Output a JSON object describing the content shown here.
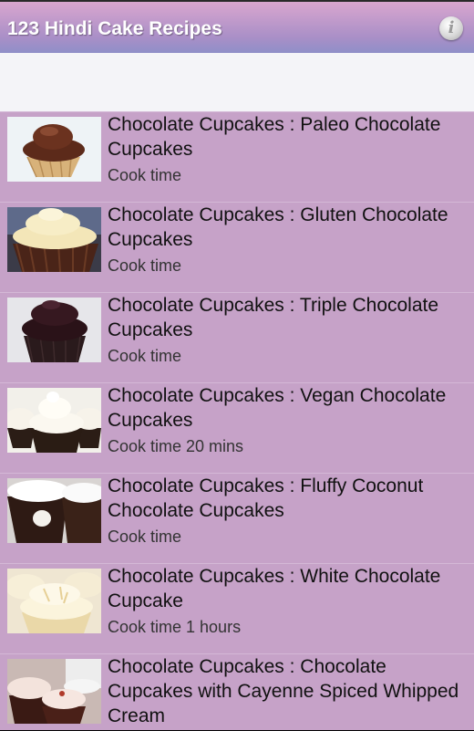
{
  "app": {
    "title": "123 Hindi Cake Recipes",
    "info_icon": "info-icon"
  },
  "colors": {
    "list_background": "#c6a2c8",
    "titlebar_top": "#d9a6cf",
    "titlebar_bottom": "#8f8fc8"
  },
  "recipes": [
    {
      "title": "Chocolate Cupcakes : Paleo Chocolate Cupcakes",
      "cook_time": "Cook time"
    },
    {
      "title": "Chocolate Cupcakes : Gluten Chocolate Cupcakes",
      "cook_time": "Cook time"
    },
    {
      "title": "Chocolate Cupcakes : Triple Chocolate Cupcakes",
      "cook_time": "Cook time"
    },
    {
      "title": "Chocolate Cupcakes : Vegan Chocolate Cupcakes",
      "cook_time": "Cook time 20 mins"
    },
    {
      "title": "Chocolate Cupcakes : Fluffy Coconut Chocolate Cupcakes",
      "cook_time": "Cook time"
    },
    {
      "title": "Chocolate Cupcakes : White Chocolate Cupcake",
      "cook_time": "Cook time 1 hours"
    },
    {
      "title": "Chocolate Cupcakes : Chocolate Cupcakes with Cayenne Spiced Whipped Cream",
      "cook_time": ""
    }
  ]
}
